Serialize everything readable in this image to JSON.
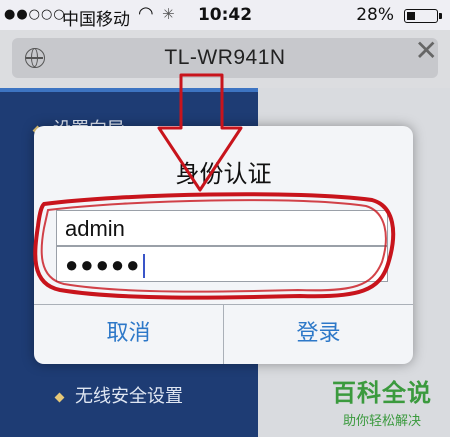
{
  "status_bar": {
    "signal": "●●○○○",
    "carrier": "中国移动",
    "time": "10:42",
    "battery": "28%",
    "battery_level": 0.28
  },
  "browser": {
    "url": "TL-WR941N",
    "globe_icon": "globe-icon",
    "close_icon": "close-icon"
  },
  "page": {
    "menu_items": [
      "设置向导",
      "无线安全设置"
    ]
  },
  "dialog": {
    "title": "身份认证",
    "username_value": "admin",
    "password_value": "●●●●●",
    "cancel_label": "取消",
    "login_label": "登录"
  },
  "annotation": {
    "color": "#c8141c"
  },
  "watermark": {
    "title": "百科全说",
    "subtitle": "助你轻松解决"
  }
}
